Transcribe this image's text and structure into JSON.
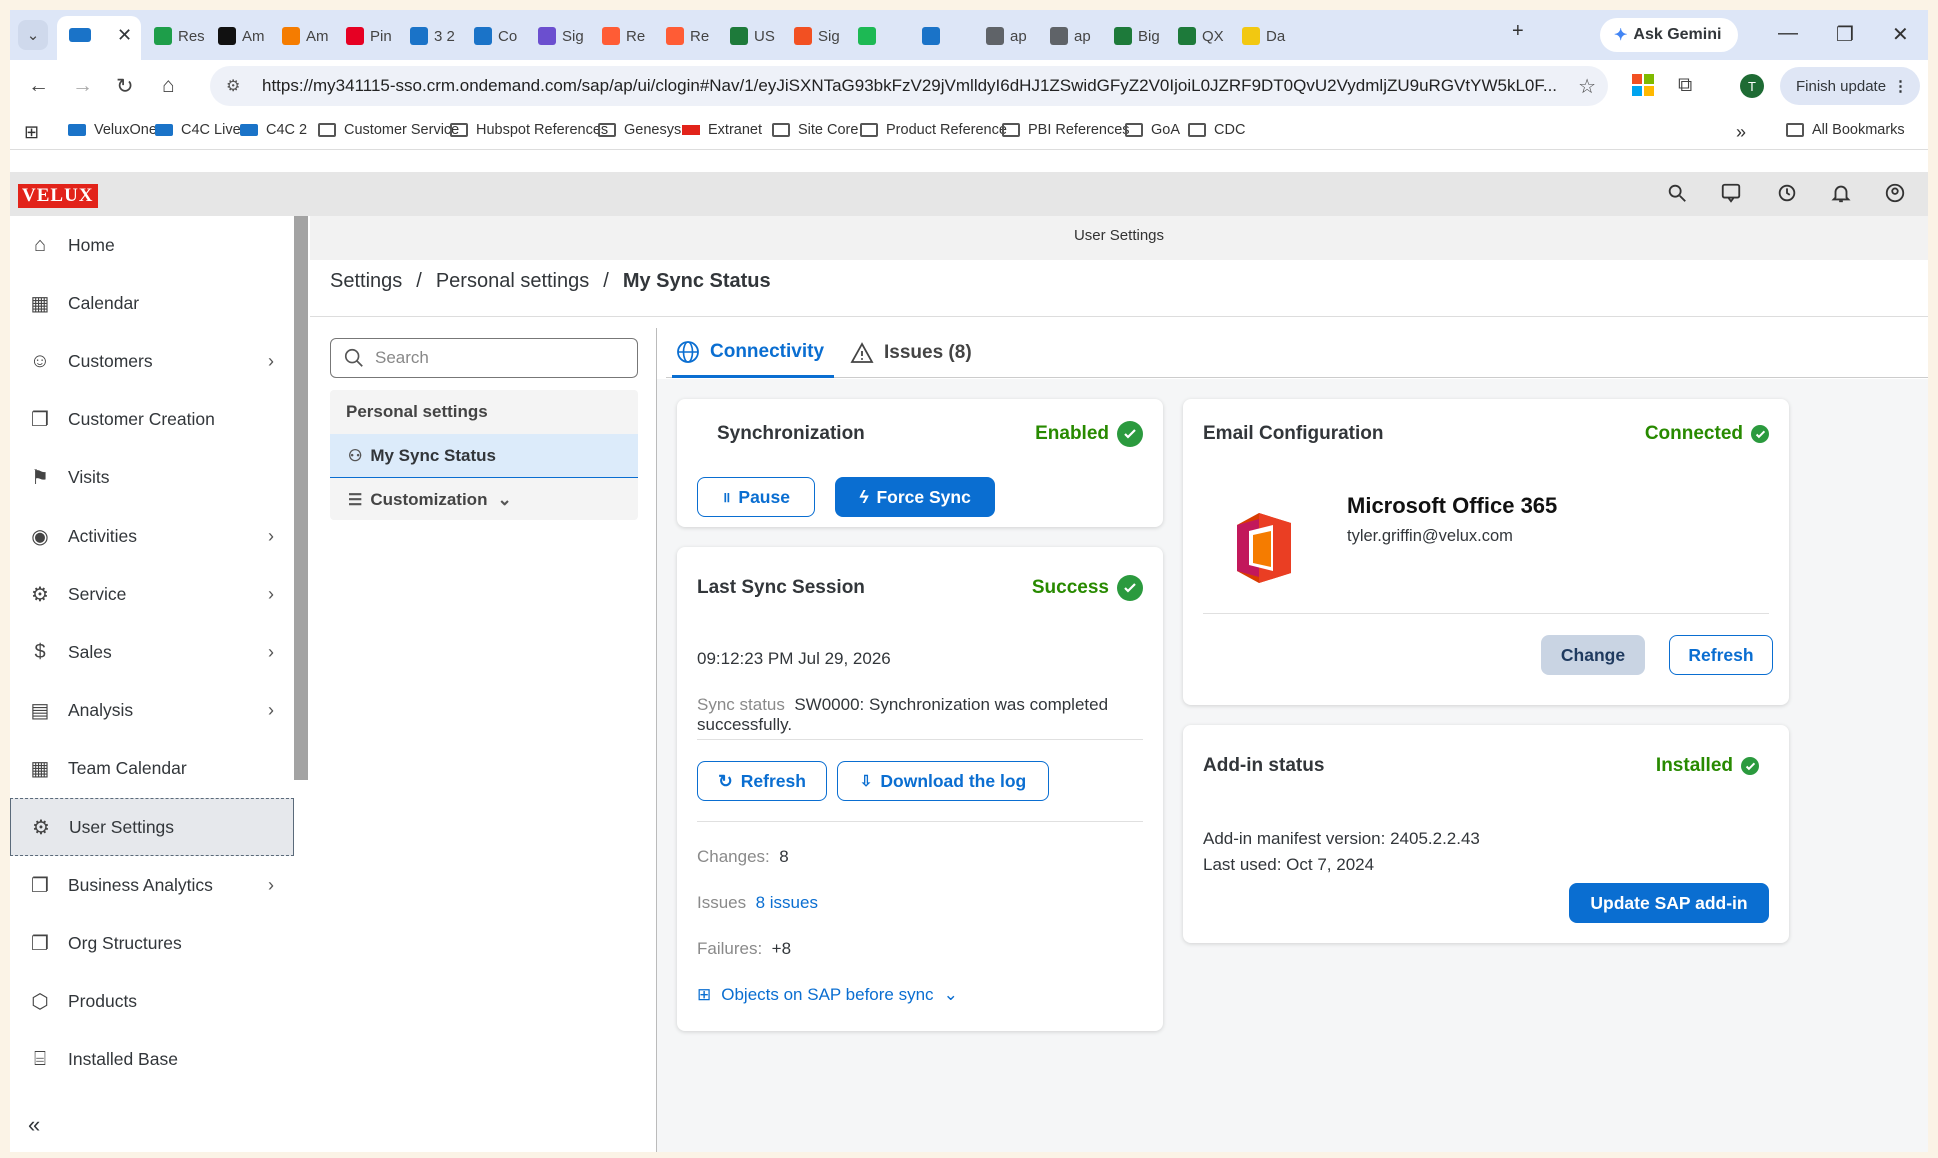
{
  "browser": {
    "tabs": [
      {
        "label": "Res",
        "color": "#1e9e4a"
      },
      {
        "label": "Am",
        "color": "#111111"
      },
      {
        "label": "Am",
        "color": "#f57c00"
      },
      {
        "label": "Pin",
        "color": "#e60023"
      },
      {
        "label": "3 2",
        "color": "#1a73c8"
      },
      {
        "label": "Co",
        "color": "#1a73c8"
      },
      {
        "label": "Sig",
        "color": "#6b4fcf"
      },
      {
        "label": "Re",
        "color": "#ff5c35"
      },
      {
        "label": "Re",
        "color": "#ff5c35"
      },
      {
        "label": "US",
        "color": "#1d7a3a"
      },
      {
        "label": "Sig",
        "color": "#f25022"
      },
      {
        "label": "",
        "color": "#1db954"
      },
      {
        "label": "",
        "color": "#1a73c8"
      },
      {
        "label": "ap",
        "color": "#5f6368"
      },
      {
        "label": "ap",
        "color": "#5f6368"
      },
      {
        "label": "Big",
        "color": "#1d7a3a"
      },
      {
        "label": "QX",
        "color": "#1d7a3a"
      },
      {
        "label": "Da",
        "color": "#f2c811"
      }
    ],
    "gemini_label": "Ask Gemini",
    "url": "https://my341115-sso.crm.ondemand.com/sap/ap/ui/clogin#Nav/1/eyJiSXNTaG93bkFzV29jVmlldyI6dHJ1ZSwidGFyZ2V0IjoiL0JZRF9DT0QvU2VydmljZU9uRGVtYW5kL0F...",
    "finish_update": "Finish update",
    "profile_initial": "T",
    "bookmarks": [
      "VeluxOne",
      "C4C Live",
      "C4C 2",
      "Customer Service",
      "Hubspot References",
      "Genesys",
      "Extranet",
      "Site Core",
      "Product Reference",
      "PBI References",
      "GoA",
      "CDC"
    ],
    "all_bookmarks": "All Bookmarks"
  },
  "app": {
    "logo": "VELUX",
    "page_title": "User Settings",
    "nav": [
      {
        "label": "Home",
        "icon": "home-icon",
        "chevron": false
      },
      {
        "label": "Calendar",
        "icon": "calendar-icon",
        "chevron": false
      },
      {
        "label": "Customers",
        "icon": "customers-icon",
        "chevron": true
      },
      {
        "label": "Customer Creation",
        "icon": "copy-icon",
        "chevron": false
      },
      {
        "label": "Visits",
        "icon": "visits-icon",
        "chevron": false
      },
      {
        "label": "Activities",
        "icon": "activities-icon",
        "chevron": true
      },
      {
        "label": "Service",
        "icon": "service-icon",
        "chevron": true
      },
      {
        "label": "Sales",
        "icon": "sales-icon",
        "chevron": true
      },
      {
        "label": "Analysis",
        "icon": "analysis-icon",
        "chevron": true
      },
      {
        "label": "Team Calendar",
        "icon": "team-calendar-icon",
        "chevron": false
      },
      {
        "label": "User Settings",
        "icon": "user-settings-icon",
        "chevron": false,
        "selected": true
      },
      {
        "label": "Business Analytics",
        "icon": "copy-icon",
        "chevron": true
      },
      {
        "label": "Org Structures",
        "icon": "copy-icon",
        "chevron": false
      },
      {
        "label": "Products",
        "icon": "products-icon",
        "chevron": false
      },
      {
        "label": "Installed Base",
        "icon": "installed-base-icon",
        "chevron": false
      }
    ],
    "breadcrumb": {
      "a": "Settings",
      "b": "Personal settings",
      "c": "My Sync Status",
      "sep": "/"
    },
    "search_placeholder": "Search",
    "tree": {
      "group": "Personal settings",
      "item": "My Sync Status",
      "custom": "Customization"
    },
    "tabs": {
      "connectivity": "Connectivity",
      "issues": "Issues (8)"
    },
    "sync": {
      "title": "Synchronization",
      "status": "Enabled",
      "pause": "Pause",
      "force": "Force Sync"
    },
    "last": {
      "title": "Last Sync Session",
      "status": "Success",
      "timestamp": "09:12:23 PM Jul 29, 2026",
      "sync_status_label": "Sync status",
      "sync_status": "SW0000: Synchronization was completed successfully.",
      "refresh": "Refresh",
      "download": "Download the log",
      "changes_label": "Changes:",
      "changes": "8",
      "issues_label": "Issues",
      "issues": "8 issues",
      "failures_label": "Failures:",
      "failures": "+8",
      "objects": "Objects on SAP before sync"
    },
    "email": {
      "title": "Email Configuration",
      "status": "Connected",
      "provider": "Microsoft Office 365",
      "address": "tyler.griffin@velux.com",
      "change": "Change",
      "refresh": "Refresh"
    },
    "addin": {
      "title": "Add-in status",
      "status": "Installed",
      "manifest": "Add-in manifest version: 2405.2.2.43",
      "last_used": "Last used: Oct 7, 2024",
      "update": "Update SAP add-in"
    }
  },
  "colors": {
    "accent": "#0a6ed1",
    "success": "#288a00",
    "velux_red": "#e2231a"
  }
}
